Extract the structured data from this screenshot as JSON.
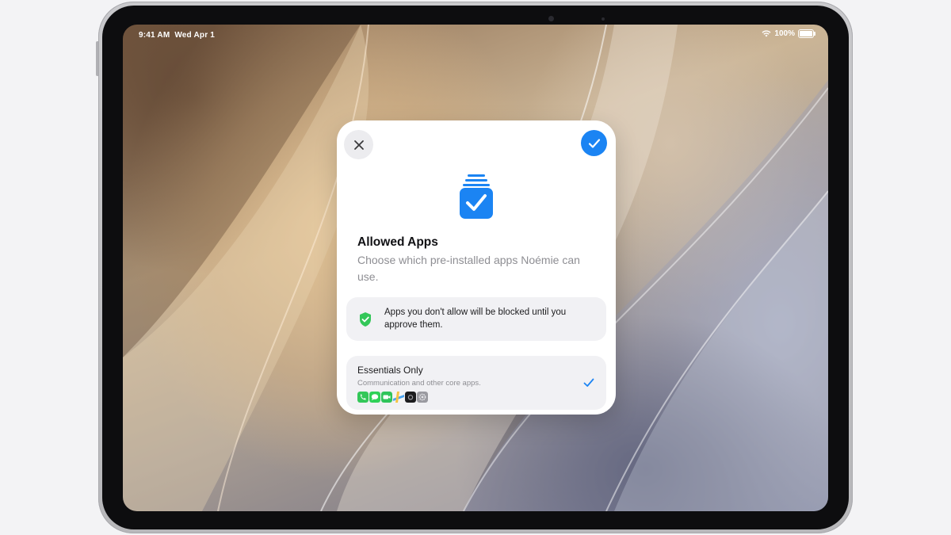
{
  "status_bar": {
    "time_date": "9:41 AM  Wed Apr 1",
    "battery": "100%"
  },
  "sheet": {
    "title": "Allowed Apps",
    "subtitle": "Choose which pre-installed apps Noémie can use.",
    "notice": "Apps you don't allow will be blocked until you approve them.",
    "option": {
      "title": "Essentials Only",
      "description": "Communication and other core apps.",
      "selected": true,
      "apps": [
        {
          "name": "phone-app-icon",
          "color": "#34c759"
        },
        {
          "name": "messages-app-icon",
          "color": "#30d158"
        },
        {
          "name": "facetime-app-icon",
          "color": "#2fc45a"
        },
        {
          "name": "maps-app-icon",
          "color": "#4aa3f0"
        },
        {
          "name": "camera-app-icon",
          "color": "#1c1c1e"
        },
        {
          "name": "settings-app-icon",
          "color": "#9a9aa0"
        }
      ]
    }
  },
  "colors": {
    "accent": "#1b84f3",
    "shield_green": "#34c759"
  }
}
